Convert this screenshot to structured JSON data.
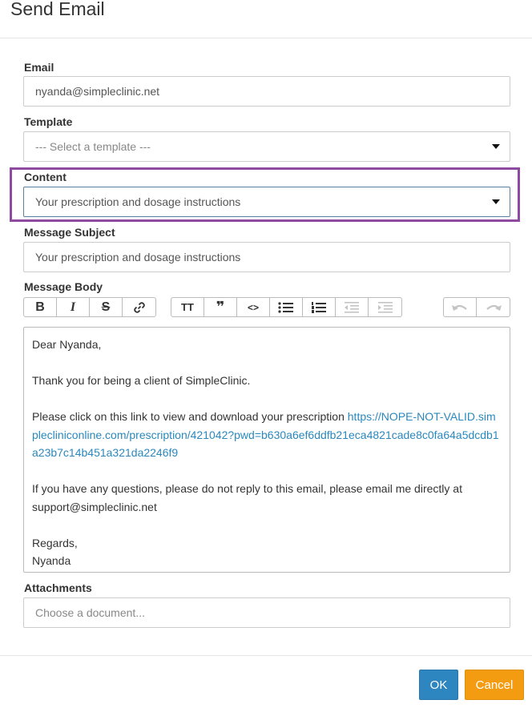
{
  "dialog": {
    "title": "Send Email"
  },
  "email": {
    "label": "Email",
    "value": "nyanda@simpleclinic.net"
  },
  "template": {
    "label": "Template",
    "value": "--- Select a template ---"
  },
  "content": {
    "label": "Content",
    "value": "Your prescription and dosage instructions"
  },
  "subject": {
    "label": "Message Subject",
    "value": "Your prescription and dosage instructions"
  },
  "body": {
    "label": "Message Body",
    "greeting": "Dear Nyanda,",
    "line1": "Thank you for being a client of SimpleClinic.",
    "line2_prefix": "Please click on this link to view and download your prescription ",
    "link": "https://NOPE-NOT-VALID.simplecliniconline.com/prescription/421042?pwd=b630a6ef6ddfb21eca4821cade8c0fa64a5dcdb1a23b7c14b451a321da2246f9",
    "line3": "If you have any questions, please do not reply to this email, please email me directly at support@simpleclinic.net",
    "signoff": "Regards,",
    "signature": "Nyanda"
  },
  "toolbar": {
    "icons": [
      "bold-icon",
      "italic-icon",
      "strikethrough-icon",
      "link-icon",
      "heading-icon",
      "quote-icon",
      "code-icon",
      "bullet-list-icon",
      "numbered-list-icon",
      "outdent-icon",
      "indent-icon",
      "undo-icon",
      "redo-icon"
    ],
    "bold": "B",
    "italic": "I",
    "strike": "S",
    "heading": "TT",
    "quote": "❞",
    "code": "<>"
  },
  "attachments": {
    "label": "Attachments",
    "placeholder": "Choose a document..."
  },
  "buttons": {
    "ok": "OK",
    "cancel": "Cancel"
  },
  "colors": {
    "highlight": "#8e4a9e",
    "ok": "#2e86c1",
    "cancel": "#f39c12",
    "link": "#2a88bd"
  }
}
